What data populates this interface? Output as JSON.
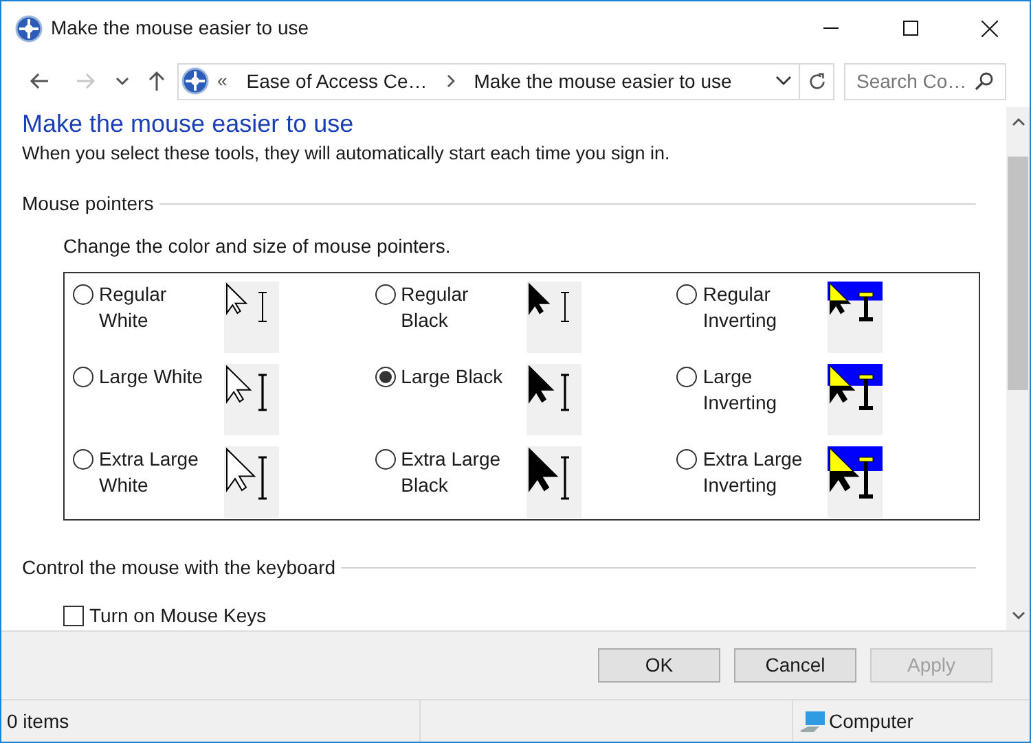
{
  "window": {
    "title": "Make the mouse easier to use"
  },
  "navigation": [
    {
      "kind": "back",
      "disabled": false
    },
    {
      "kind": "forward",
      "disabled": true
    },
    {
      "kind": "recent",
      "disabled": false
    },
    {
      "kind": "up",
      "disabled": false
    }
  ],
  "address": {
    "overflow": "«",
    "crumbs": [
      "Ease of Access Ce…",
      "Make the mouse easier to use"
    ]
  },
  "search": {
    "placeholder": "Search Co…"
  },
  "heading": "Make the mouse easier to use",
  "intro": "When you select these tools, they will automatically start each time you sign in.",
  "mouse_pointers": {
    "title": "Mouse pointers",
    "instruction": "Change the color and size of mouse pointers.",
    "schemes": [
      {
        "label": "Regular White",
        "selected": false,
        "kind": "white"
      },
      {
        "label": "Regular Black",
        "selected": false,
        "kind": "black"
      },
      {
        "label": "Regular Inverting",
        "selected": false,
        "kind": "inverting"
      },
      {
        "label": "Large White",
        "selected": false,
        "kind": "white"
      },
      {
        "label": "Large Black",
        "selected": true,
        "kind": "black"
      },
      {
        "label": "Large Inverting",
        "selected": false,
        "kind": "inverting"
      },
      {
        "label": "Extra Large White",
        "selected": false,
        "kind": "white"
      },
      {
        "label": "Extra Large Black",
        "selected": false,
        "kind": "black"
      },
      {
        "label": "Extra Large Inverting",
        "selected": false,
        "kind": "inverting"
      }
    ]
  },
  "keyboard": {
    "title": "Control the mouse with the keyboard",
    "options": [
      {
        "label": "Turn on Mouse Keys",
        "checked": false
      }
    ]
  },
  "buttons": [
    {
      "label": "OK",
      "disabled": false
    },
    {
      "label": "Cancel",
      "disabled": false
    },
    {
      "label": "Apply",
      "disabled": true
    }
  ],
  "status_bar": {
    "items": "0 items",
    "location": "Computer"
  }
}
